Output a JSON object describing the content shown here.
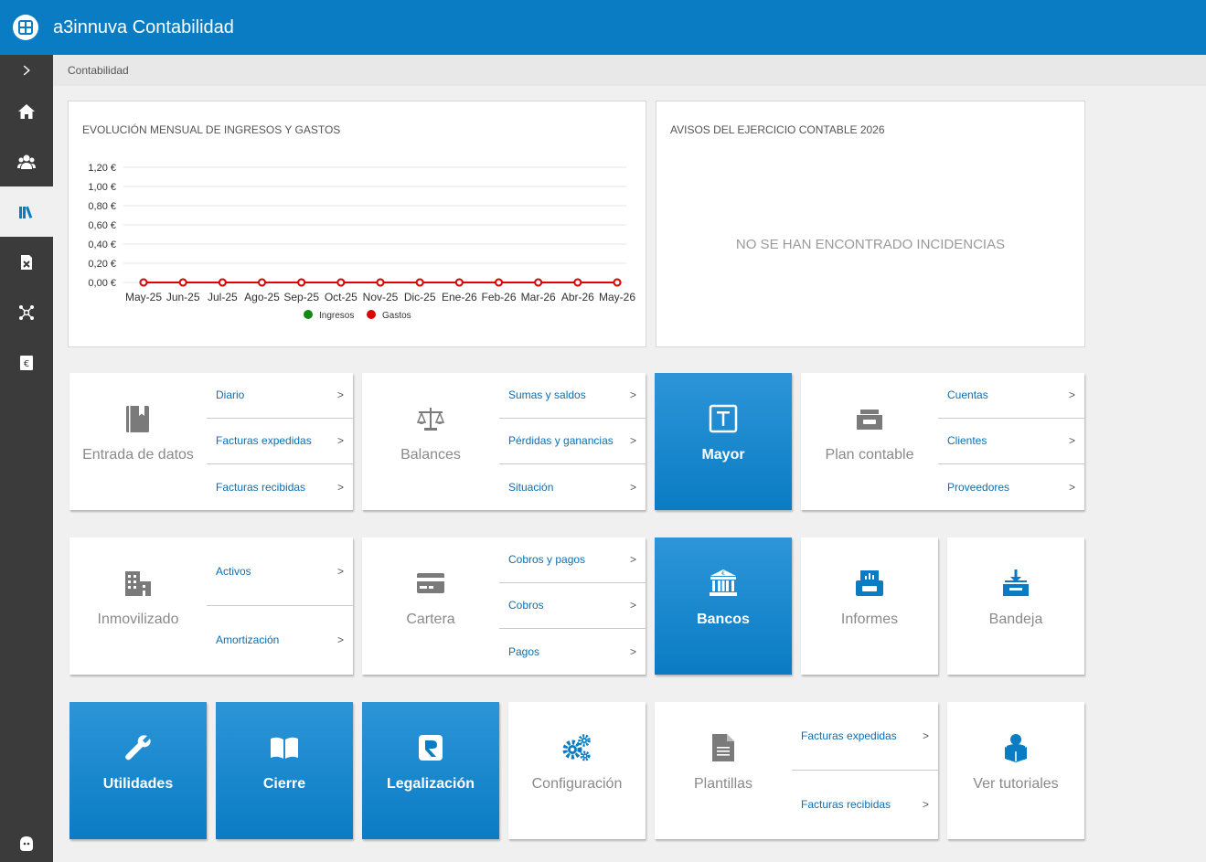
{
  "app": {
    "title": "a3innuva Contabilidad"
  },
  "breadcrumb": "Contabilidad",
  "sidebar": {
    "items": [
      {
        "name": "expand",
        "icon": "chevron-right-icon"
      },
      {
        "name": "home",
        "icon": "home-icon"
      },
      {
        "name": "clients",
        "icon": "users-icon"
      },
      {
        "name": "accounting",
        "icon": "books-icon",
        "active": true
      },
      {
        "name": "documents",
        "icon": "document-icon"
      },
      {
        "name": "connections",
        "icon": "network-icon"
      },
      {
        "name": "billing",
        "icon": "euro-icon"
      }
    ],
    "bottom_icon": "support-icon"
  },
  "chart_panel": {
    "title": "EVOLUCIÓN MENSUAL DE INGRESOS Y GASTOS"
  },
  "chart_data": {
    "type": "line",
    "title": "EVOLUCIÓN MENSUAL DE INGRESOS Y GASTOS",
    "categories": [
      "May-25",
      "Jun-25",
      "Jul-25",
      "Ago-25",
      "Sep-25",
      "Oct-25",
      "Nov-25",
      "Dic-25",
      "Ene-26",
      "Feb-26",
      "Mar-26",
      "Abr-26",
      "May-26"
    ],
    "y_ticks": [
      "1,20 €",
      "1,00 €",
      "0,80 €",
      "0,60 €",
      "0,40 €",
      "0,20 €",
      "0,00 €"
    ],
    "ylim": [
      0,
      1.2
    ],
    "series": [
      {
        "name": "Ingresos",
        "color": "#138a13",
        "values": [
          0,
          0,
          0,
          0,
          0,
          0,
          0,
          0,
          0,
          0,
          0,
          0,
          0
        ]
      },
      {
        "name": "Gastos",
        "color": "#e00000",
        "values": [
          0,
          0,
          0,
          0,
          0,
          0,
          0,
          0,
          0,
          0,
          0,
          0,
          0
        ]
      }
    ],
    "legend": "bottom",
    "grid": true
  },
  "notices_panel": {
    "title": "AVISOS DEL EJERCICIO CONTABLE 2026",
    "empty_text": "NO SE HAN ENCONTRADO INCIDENCIAS"
  },
  "tiles": {
    "entrada": {
      "label": "Entrada de datos",
      "icon": "book-icon",
      "links": [
        {
          "label": "Diario"
        },
        {
          "label": "Facturas expedidas"
        },
        {
          "label": "Facturas recibidas"
        }
      ]
    },
    "balances": {
      "label": "Balances",
      "icon": "scale-icon",
      "links": [
        {
          "label": "Sumas y saldos"
        },
        {
          "label": "Pérdidas y ganancias"
        },
        {
          "label": "Situación"
        }
      ]
    },
    "mayor": {
      "label": "Mayor",
      "icon": "ledger-t-icon"
    },
    "plan": {
      "label": "Plan contable",
      "icon": "filing-drawer-icon",
      "links": [
        {
          "label": "Cuentas"
        },
        {
          "label": "Clientes"
        },
        {
          "label": "Proveedores"
        }
      ]
    },
    "inmovilizado": {
      "label": "Inmovilizado",
      "icon": "building-icon",
      "links": [
        {
          "label": "Activos"
        },
        {
          "label": "Amortización"
        }
      ]
    },
    "cartera": {
      "label": "Cartera",
      "icon": "card-icon",
      "links": [
        {
          "label": "Cobros y pagos"
        },
        {
          "label": "Cobros"
        },
        {
          "label": "Pagos"
        }
      ]
    },
    "bancos": {
      "label": "Bancos",
      "icon": "bank-icon"
    },
    "informes": {
      "label": "Informes",
      "icon": "report-printer-icon"
    },
    "bandeja": {
      "label": "Bandeja",
      "icon": "inbox-icon"
    },
    "utilidades": {
      "label": "Utilidades",
      "icon": "wrench-icon"
    },
    "cierre": {
      "label": "Cierre",
      "icon": "open-book-icon"
    },
    "legalizacion": {
      "label": "Legalización",
      "icon": "registry-icon"
    },
    "configuracion": {
      "label": "Configuración",
      "icon": "gears-icon"
    },
    "plantillas": {
      "label": "Plantillas",
      "icon": "template-doc-icon",
      "links": [
        {
          "label": "Facturas expedidas"
        },
        {
          "label": "Facturas recibidas"
        }
      ]
    },
    "tutoriales": {
      "label": "Ver tutoriales",
      "icon": "reader-icon"
    }
  },
  "chevron": ">",
  "colors": {
    "brand": "#0a7cc4",
    "sidebar": "#3b3b3b",
    "link": "#0a6fb5",
    "icon_gray": "#7a7a7a"
  }
}
